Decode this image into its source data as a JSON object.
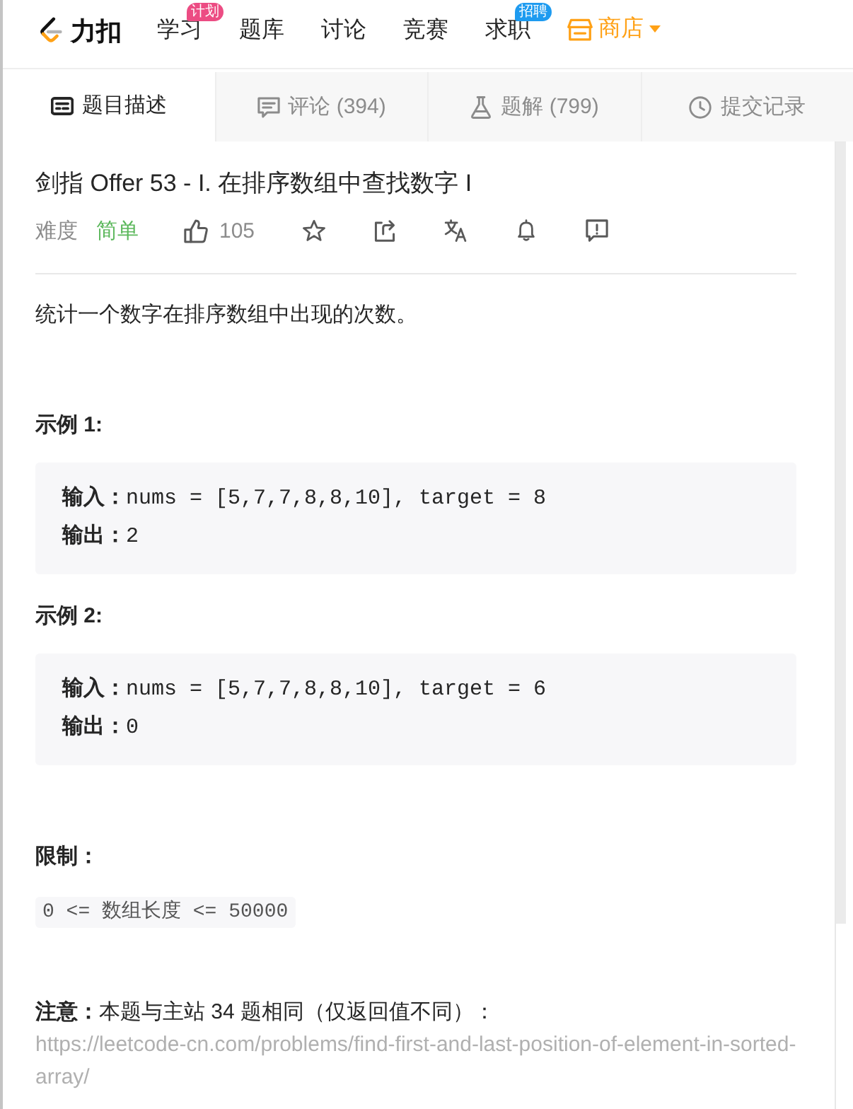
{
  "nav": {
    "logo_text": "力扣",
    "items": [
      {
        "label": "学习",
        "kind": "link",
        "badge": {
          "text": "计划",
          "color": "#ec4c83"
        }
      },
      {
        "label": "题库",
        "kind": "link"
      },
      {
        "label": "讨论",
        "kind": "link"
      },
      {
        "label": "竞赛",
        "kind": "link"
      },
      {
        "label": "求职",
        "kind": "link",
        "badge": {
          "text": "招聘",
          "color": "#1e9bf0"
        }
      },
      {
        "label": "商店",
        "kind": "store"
      }
    ]
  },
  "tabs": [
    {
      "label": "题目描述",
      "selected": true
    },
    {
      "label": "评论 (394)",
      "selected": false
    },
    {
      "label": "题解 (799)",
      "selected": false
    },
    {
      "label": "提交记录",
      "selected": false
    }
  ],
  "problem": {
    "title": "剑指 Offer 53 - I. 在排序数组中查找数字 I",
    "difficulty_label": "难度",
    "difficulty": {
      "text": "简单",
      "kind": "easy"
    },
    "likes": "105",
    "description": "统计一个数字在排序数组中出现的次数。",
    "examples": [
      {
        "heading": "示例 1:",
        "lines": [
          "**输入：**nums = [5,7,7,8,8,10], target = 8",
          "**输出：**2"
        ]
      },
      {
        "heading": "示例 2:",
        "lines": [
          "**输入：**nums = [5,7,7,8,8,10], target = 6",
          "**输出：**0"
        ]
      }
    ],
    "constraints": {
      "heading": "限制：",
      "code": "0 <= 数组长度 <= 50000"
    },
    "note": {
      "text": "**注意：**本题与主站 34 题相同（仅返回值不同）：",
      "link": "https://leetcode-cn.com/problems/find-first-and-last-position-of-element-in-sorted-array/"
    }
  }
}
